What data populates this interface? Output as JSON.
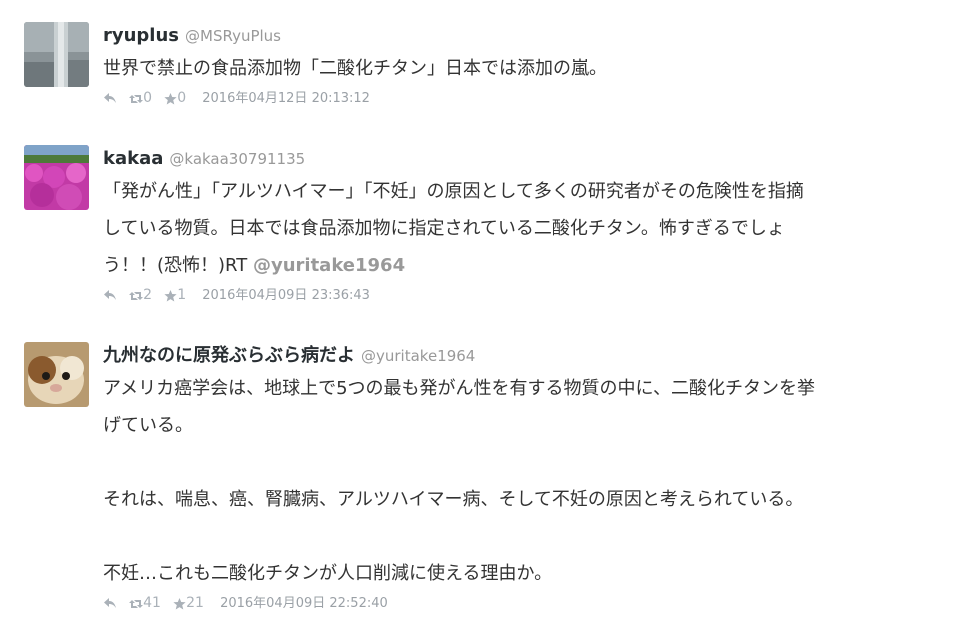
{
  "tweets": [
    {
      "name": "ryuplus",
      "handle": "@MSRyuPlus",
      "lines": [
        "世界で禁止の食品添加物「二酸化チタン」日本では添加の嵐。"
      ],
      "retweets": "0",
      "favorites": "0",
      "timestamp": "2016年04月12日 20:13:12"
    },
    {
      "name": "kakaa",
      "handle": "@kakaa30791135",
      "lines": [
        "「発がん性」「アルツハイマー」「不妊」の原因として多くの研究者がその危険性を指摘",
        "している物質。日本では食品添加物に指定されている二酸化チタン。怖すぎるでしょ",
        "う！！(恐怖！)RT "
      ],
      "mention": "@yuritake1964",
      "retweets": "2",
      "favorites": "1",
      "timestamp": "2016年04月09日 23:36:43"
    },
    {
      "name": "九州なのに原発ぶらぶら病だよ",
      "handle": "@yuritake1964",
      "lines": [
        "アメリカ癌学会は、地球上で5つの最も発がん性を有する物質の中に、二酸化チタンを挙",
        "げている。",
        "",
        "それは、喘息、癌、腎臓病、アルツハイマー病、そして不妊の原因と考えられている。",
        "",
        "不妊…これも二酸化チタンが人口削減に使える理由か。"
      ],
      "retweets": "41",
      "favorites": "21",
      "timestamp": "2016年04月09日 22:52:40"
    }
  ],
  "icons": {
    "reply": "reply-arrow-icon",
    "retweet": "retweet-icon",
    "favorite": "star-icon"
  },
  "colors": {
    "name": "#292f33",
    "meta": "#aab1b8",
    "text": "#333333"
  }
}
